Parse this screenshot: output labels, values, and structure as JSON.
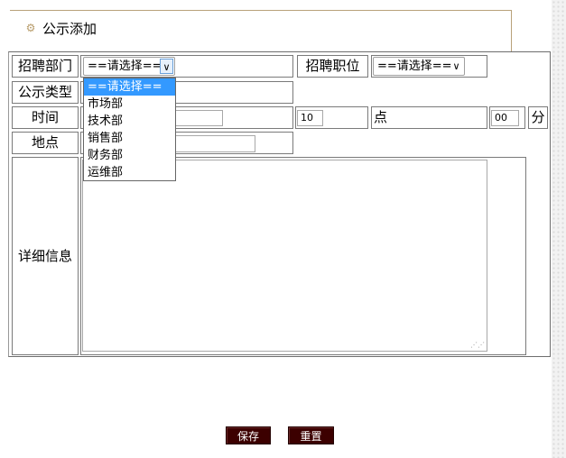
{
  "header": {
    "title": "公示添加",
    "icon": "gear-icon"
  },
  "form": {
    "recruit_dept_label": "招聘部门",
    "recruit_dept_value": "==请选择==",
    "recruit_position_label": "招聘职位",
    "recruit_position_value": "==请选择==",
    "notice_type_label": "公示类型",
    "time_label": "时间",
    "hour_value": "10",
    "hour_unit": "点",
    "minute_value": "00",
    "minute_unit": "分",
    "location_label": "地点",
    "detail_label": "详细信息"
  },
  "dropdown": {
    "options": [
      "==请选择==",
      "市场部",
      "技术部",
      "销售部",
      "财务部",
      "运维部"
    ]
  },
  "buttons": {
    "save": "保存",
    "reset": "重置"
  },
  "colors": {
    "button_bg": "#3c0000",
    "selected_option_bg": "#3399ff",
    "header_border": "#b8a17a"
  }
}
